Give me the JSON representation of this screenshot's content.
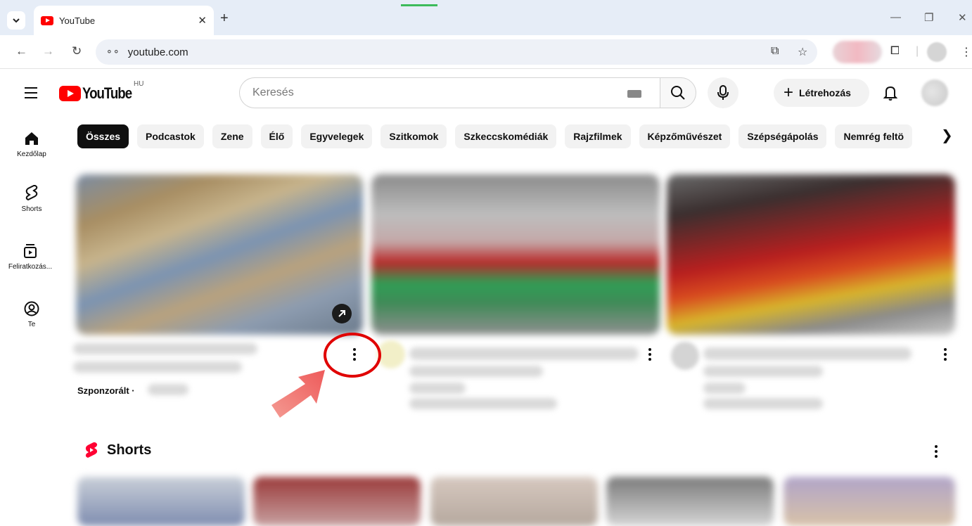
{
  "browser": {
    "tab_title": "YouTube",
    "tab_close": "✕",
    "new_tab": "+",
    "url": "youtube.com",
    "window_controls": {
      "minimize": "—",
      "restore": "❐",
      "close": "✕"
    }
  },
  "youtube": {
    "logo_text": "YouTube",
    "country_code": "HU",
    "search_placeholder": "Keresés",
    "create_label": "Létrehozás"
  },
  "sidebar": {
    "items": [
      {
        "label": "Kezdőlap",
        "icon": "home-icon"
      },
      {
        "label": "Shorts",
        "icon": "shorts-icon"
      },
      {
        "label": "Feliratkozás...",
        "icon": "subscriptions-icon"
      },
      {
        "label": "Te",
        "icon": "you-icon"
      }
    ]
  },
  "chips": [
    {
      "label": "Összes",
      "active": true
    },
    {
      "label": "Podcastok"
    },
    {
      "label": "Zene"
    },
    {
      "label": "Élő"
    },
    {
      "label": "Egyvelegek"
    },
    {
      "label": "Szitkomok"
    },
    {
      "label": "Szkeccskomédiák"
    },
    {
      "label": "Rajzfilmek"
    },
    {
      "label": "Képzőművészet"
    },
    {
      "label": "Szépségápolás"
    },
    {
      "label": "Nemrég feltö"
    }
  ],
  "videos": {
    "sponsored_label": "Szponzorált ·"
  },
  "shorts": {
    "title": "Shorts"
  },
  "colors": {
    "brand_red": "#ff0000",
    "highlight_red": "#e00000",
    "arrow_pink": "#f06c6c"
  }
}
